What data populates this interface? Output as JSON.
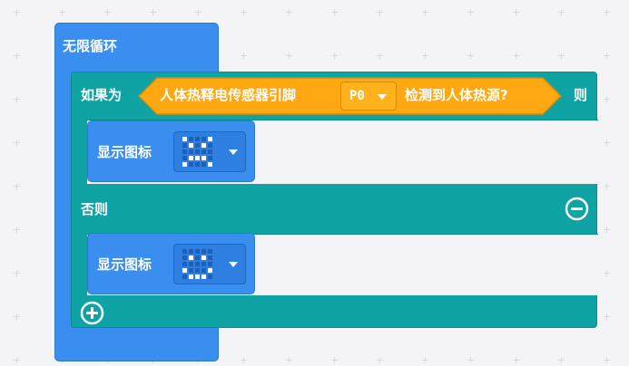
{
  "blocks": {
    "forever": {
      "label": "无限循环"
    },
    "if_block": {
      "if_label": "如果为",
      "condition": {
        "prefix": "人体热释电传感器引脚",
        "pin_value": "P0",
        "suffix": "检测到人体热源?"
      },
      "then_label": "则",
      "else_label": "否则"
    },
    "show_icon_1": {
      "label": "显示图标",
      "pattern": [
        [
          1,
          0,
          0,
          0,
          1
        ],
        [
          0,
          1,
          0,
          1,
          0
        ],
        [
          0,
          0,
          0,
          0,
          0
        ],
        [
          0,
          1,
          1,
          1,
          0
        ],
        [
          1,
          0,
          0,
          0,
          1
        ]
      ]
    },
    "show_icon_2": {
      "label": "显示图标",
      "pattern": [
        [
          0,
          0,
          0,
          0,
          0
        ],
        [
          0,
          1,
          0,
          1,
          0
        ],
        [
          0,
          0,
          0,
          0,
          0
        ],
        [
          1,
          0,
          0,
          0,
          1
        ],
        [
          0,
          1,
          1,
          1,
          0
        ]
      ]
    }
  },
  "colors": {
    "workspace": "#f4f4f6",
    "control_blue": "#3a8ef0",
    "logic_teal": "#0fa3a4",
    "sensor_orange": "#ffa812",
    "led_on": "#ffffff"
  }
}
